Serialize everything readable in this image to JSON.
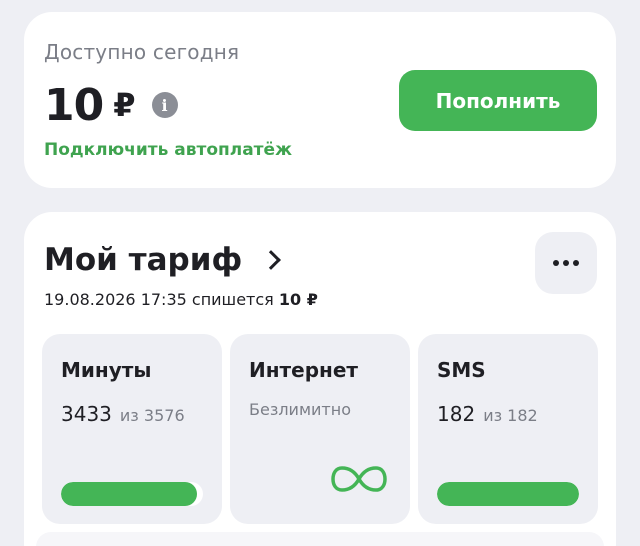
{
  "balance": {
    "label": "Доступно сегодня",
    "amount": "10",
    "currency": "₽",
    "topup_label": "Пополнить",
    "autopay_label": "Подключить автоплатёж"
  },
  "tariff": {
    "title": "Мой тариф",
    "charge_prefix": "19.08.2026 17:35 спишется",
    "charge_amount": "10 ₽",
    "tiles": [
      {
        "title": "Минуты",
        "value": "3433",
        "of_label": "из 3576",
        "progress": 0.96
      },
      {
        "title": "Интернет",
        "subtitle": "Безлимитно",
        "icon": "infinity-icon"
      },
      {
        "title": "SMS",
        "value": "182",
        "of_label": "из 182",
        "progress": 1.0
      }
    ]
  },
  "colors": {
    "accent": "#44b556",
    "accent_text": "#3fa34f",
    "background": "#eeeff4",
    "card": "#ffffff"
  }
}
